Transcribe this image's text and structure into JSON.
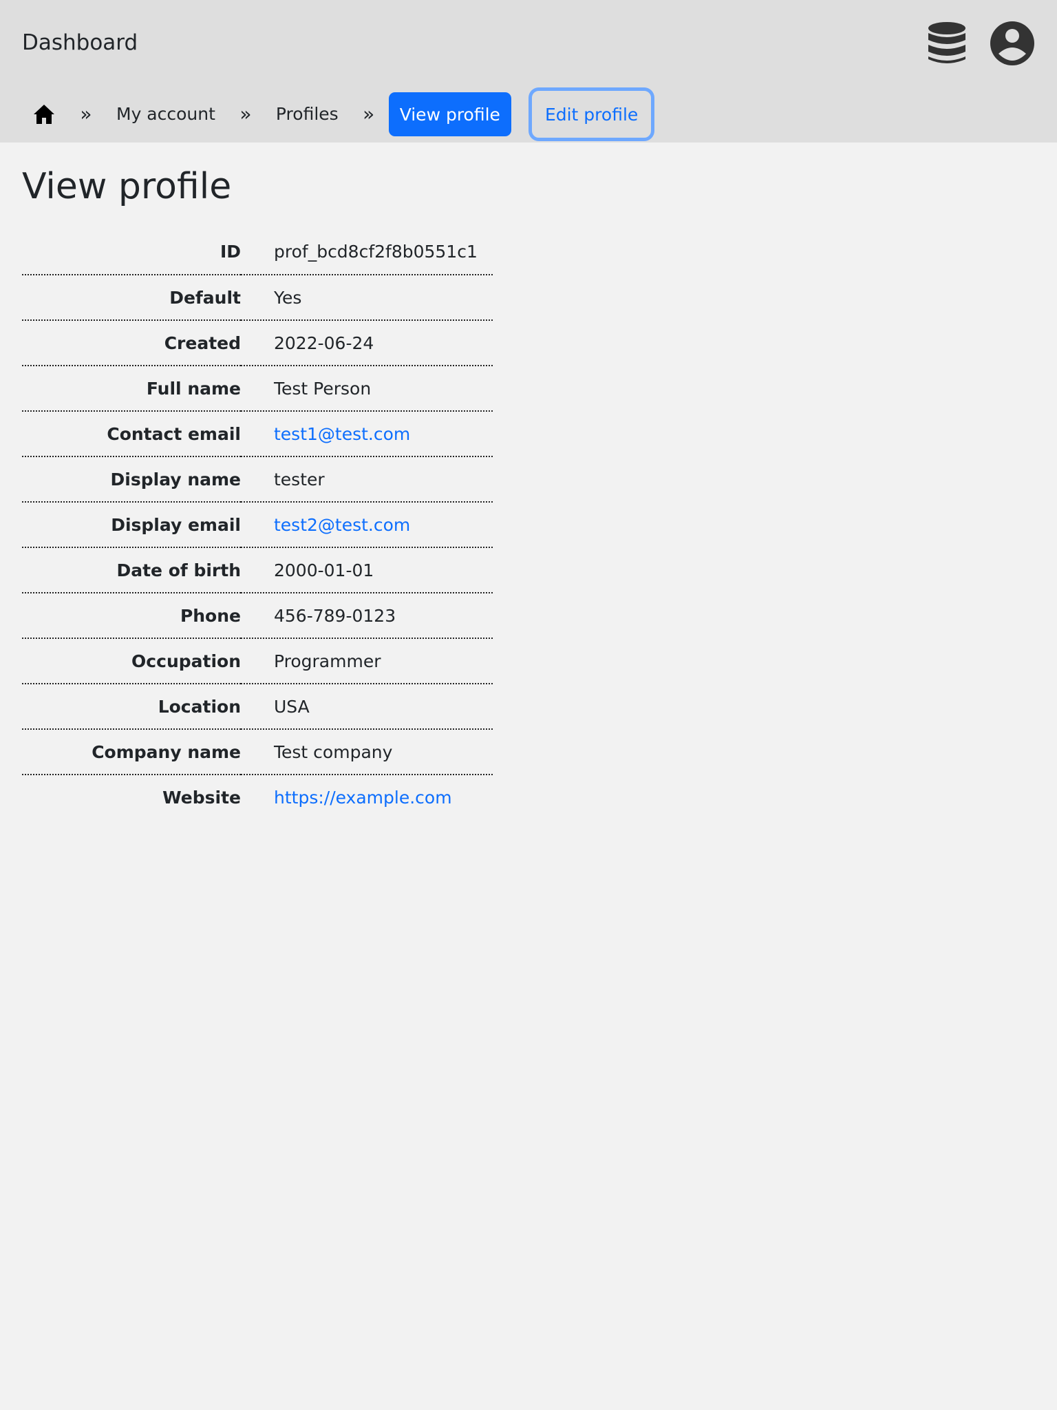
{
  "header": {
    "brand": "Dashboard",
    "icons": [
      "database-icon",
      "user-account-icon"
    ]
  },
  "breadcrumb": {
    "home_icon": "home-icon",
    "separator": "»",
    "items": [
      {
        "label": "My account"
      },
      {
        "label": "Profiles"
      }
    ],
    "active": "View profile",
    "edit": "Edit profile"
  },
  "page": {
    "title": "View profile"
  },
  "profile": [
    {
      "label": "ID",
      "value": "prof_bcd8cf2f8b0551c1"
    },
    {
      "label": "Default",
      "value": "Yes"
    },
    {
      "label": "Created",
      "value": "2022-06-24"
    },
    {
      "label": "Full name",
      "value": "Test Person"
    },
    {
      "label": "Contact email",
      "value": "test1@test.com"
    },
    {
      "label": "Display name",
      "value": "tester"
    },
    {
      "label": "Display email",
      "value": "test2@test.com"
    },
    {
      "label": "Date of birth",
      "value": "2000-01-01"
    },
    {
      "label": "Phone",
      "value": "456-789-0123"
    },
    {
      "label": "Occupation",
      "value": "Programmer"
    },
    {
      "label": "Location",
      "value": "USA"
    },
    {
      "label": "Company name",
      "value": "Test company"
    },
    {
      "label": "Website",
      "value": "https://example.com"
    }
  ],
  "colors": {
    "header_bg": "#dedede",
    "page_bg": "#f2f2f2",
    "primary": "#0d6efd",
    "focus_ring": "#6ea8fe",
    "text": "#212529"
  }
}
